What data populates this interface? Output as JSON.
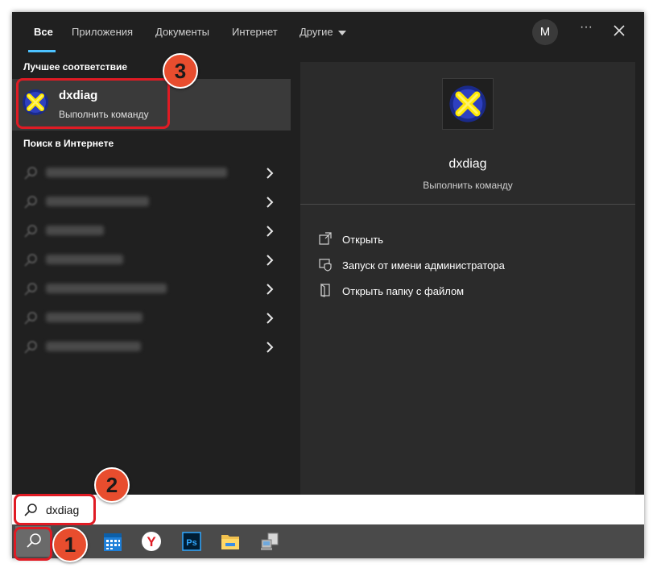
{
  "tabs": [
    {
      "label": "Все"
    },
    {
      "label": "Приложения"
    },
    {
      "label": "Документы"
    },
    {
      "label": "Интернет"
    },
    {
      "label": "Другие"
    }
  ],
  "user": {
    "avatar_letter": "M"
  },
  "more_label": "···",
  "left_panel": {
    "best_match_label": "Лучшее соответствие",
    "best_match": {
      "title": "dxdiag",
      "subtitle": "Выполнить команду",
      "icon": "directx-icon"
    },
    "web_label": "Поиск в Интернете",
    "web_items_count_note": "7 blurred suggestions"
  },
  "right_panel": {
    "title": "dxdiag",
    "subtitle": "Выполнить команду",
    "actions": [
      {
        "label": "Открыть",
        "icon": "open-icon"
      },
      {
        "label": "Запуск от имени администратора",
        "icon": "shield-icon"
      },
      {
        "label": "Открыть папку с файлом",
        "icon": "folder-icon"
      }
    ]
  },
  "search": {
    "value": "dxdiag"
  },
  "taskbar": {
    "icons": [
      "search-icon",
      "calendar-icon",
      "yandex-browser-icon",
      "photoshop-icon",
      "file-explorer-icon",
      "network-computer-icon"
    ],
    "photoshop_text": "Ps",
    "yandex_text": "Y"
  },
  "badges": {
    "one": "1",
    "two": "2",
    "three": "3"
  },
  "colors": {
    "accent": "#4cc2ff",
    "highlight": "#e01b24",
    "badge": "#e84d2e",
    "panel_bg": "#202020",
    "preview_bg": "#2b2b2b"
  }
}
